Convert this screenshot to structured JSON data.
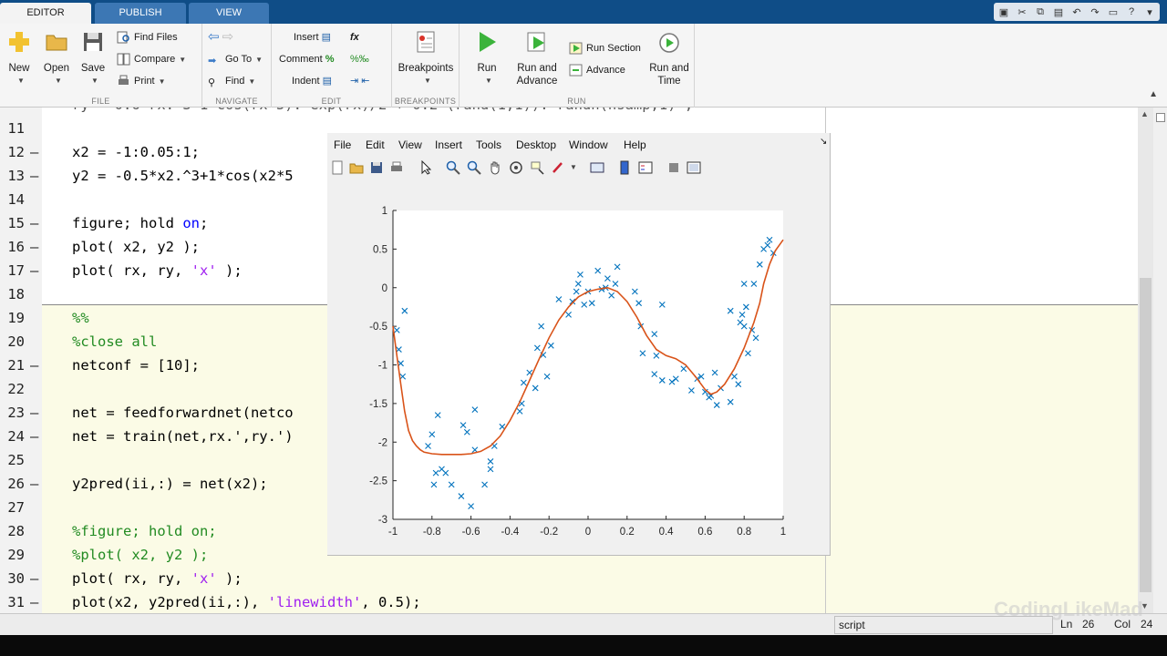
{
  "tabs": [
    "EDITOR",
    "PUBLISH",
    "VIEW"
  ],
  "ribbon": {
    "file": {
      "title": "FILE",
      "new": "New",
      "open": "Open",
      "save": "Save",
      "find_files": "Find Files",
      "compare": "Compare",
      "print": "Print"
    },
    "navigate": {
      "title": "NAVIGATE",
      "go_to": "Go To",
      "find": "Find"
    },
    "edit": {
      "title": "EDIT",
      "insert": "Insert",
      "fx": "fx",
      "comment": "Comment",
      "comment_symbol": "%",
      "indent": "Indent"
    },
    "breakpoints": {
      "title": "BREAKPOINTS",
      "label": "Breakpoints"
    },
    "run": {
      "title": "RUN",
      "run": "Run",
      "run_and_advance_1": "Run and",
      "run_and_advance_2": "Advance",
      "run_section": "Run Section",
      "advance": "Advance",
      "run_and_time_1": "Run and",
      "run_and_time_2": "Time"
    }
  },
  "editor": {
    "lines": [
      {
        "num": "11",
        "dash": false,
        "code": ""
      },
      {
        "num": "12",
        "dash": true,
        "code": "x2 = -1:0.05:1;"
      },
      {
        "num": "13",
        "dash": true,
        "code": "y2 = -0.5*x2.^3+1*cos(x2*5"
      },
      {
        "num": "14",
        "dash": false,
        "code": ""
      },
      {
        "num": "15",
        "dash": true,
        "code_a": "figure; hold ",
        "code_kw": "on",
        "code_b": ";"
      },
      {
        "num": "16",
        "dash": true,
        "code": "plot( x2, y2 );"
      },
      {
        "num": "17",
        "dash": true,
        "code_a": "plot( rx, ry, ",
        "code_str": "'x'",
        "code_b": " );"
      },
      {
        "num": "18",
        "dash": false,
        "code": ""
      },
      {
        "num": "19",
        "dash": false,
        "comment": "%%"
      },
      {
        "num": "20",
        "dash": false,
        "comment": "%close all"
      },
      {
        "num": "21",
        "dash": true,
        "code": "netconf = [10];"
      },
      {
        "num": "22",
        "dash": false,
        "code": ""
      },
      {
        "num": "23",
        "dash": true,
        "code": "net = feedforwardnet(netco"
      },
      {
        "num": "24",
        "dash": true,
        "code": "net = train(net,rx.',ry.')"
      },
      {
        "num": "25",
        "dash": false,
        "code": ""
      },
      {
        "num": "26",
        "dash": true,
        "code": "y2pred(ii,:) = net(x2);"
      },
      {
        "num": "27",
        "dash": false,
        "code": ""
      },
      {
        "num": "28",
        "dash": false,
        "comment": "%figure; hold on;"
      },
      {
        "num": "29",
        "dash": false,
        "comment": "%plot( x2, y2 );"
      },
      {
        "num": "30",
        "dash": true,
        "code_a": "plot( rx, ry, ",
        "code_str": "'x'",
        "code_b": " );"
      },
      {
        "num": "31",
        "dash": true,
        "code_a": "plot(x2, y2pred(ii,:), ",
        "code_str": "'linewidth'",
        "code_b": ", 0.5);"
      }
    ]
  },
  "figure": {
    "menu": [
      "File",
      "Edit",
      "View",
      "Insert",
      "Tools",
      "Desktop",
      "Window",
      "Help"
    ]
  },
  "chart_data": {
    "type": "scatter",
    "xlim": [
      -1,
      1
    ],
    "ylim": [
      -3,
      1
    ],
    "xticks": [
      "-1",
      "-0.8",
      "-0.6",
      "-0.4",
      "-0.2",
      "0",
      "0.2",
      "0.4",
      "0.6",
      "0.8",
      "1"
    ],
    "yticks": [
      "1",
      "0.5",
      "0",
      "-0.5",
      "-1",
      "-1.5",
      "-2",
      "-2.5",
      "-3"
    ],
    "marker_color": "#0072bd",
    "line_color": "#d95319",
    "series": [
      {
        "type": "scatter",
        "marker": "x",
        "points": [
          [
            -0.98,
            -0.55
          ],
          [
            -0.97,
            -0.8
          ],
          [
            -0.96,
            -0.98
          ],
          [
            -0.95,
            -1.15
          ],
          [
            -0.94,
            -0.3
          ],
          [
            -0.82,
            -2.05
          ],
          [
            -0.8,
            -1.9
          ],
          [
            -0.78,
            -2.4
          ],
          [
            -0.79,
            -2.55
          ],
          [
            -0.77,
            -1.65
          ],
          [
            -0.75,
            -2.35
          ],
          [
            -0.73,
            -2.4
          ],
          [
            -0.7,
            -2.55
          ],
          [
            -0.65,
            -2.7
          ],
          [
            -0.64,
            -1.78
          ],
          [
            -0.62,
            -1.87
          ],
          [
            -0.6,
            -2.83
          ],
          [
            -0.58,
            -2.1
          ],
          [
            -0.58,
            -1.58
          ],
          [
            -0.53,
            -2.55
          ],
          [
            -0.5,
            -2.35
          ],
          [
            -0.5,
            -2.25
          ],
          [
            -0.48,
            -2.05
          ],
          [
            -0.44,
            -1.8
          ],
          [
            -0.35,
            -1.6
          ],
          [
            -0.34,
            -1.5
          ],
          [
            -0.33,
            -1.23
          ],
          [
            -0.3,
            -1.1
          ],
          [
            -0.27,
            -1.3
          ],
          [
            -0.26,
            -0.78
          ],
          [
            -0.24,
            -0.5
          ],
          [
            -0.23,
            -0.87
          ],
          [
            -0.21,
            -1.15
          ],
          [
            -0.19,
            -0.75
          ],
          [
            -0.15,
            -0.15
          ],
          [
            -0.1,
            -0.35
          ],
          [
            -0.08,
            -0.18
          ],
          [
            -0.06,
            -0.05
          ],
          [
            -0.05,
            0.05
          ],
          [
            -0.04,
            0.17
          ],
          [
            -0.02,
            -0.22
          ],
          [
            0.0,
            -0.05
          ],
          [
            0.02,
            -0.2
          ],
          [
            0.05,
            0.22
          ],
          [
            0.07,
            -0.02
          ],
          [
            0.09,
            0.0
          ],
          [
            0.1,
            0.12
          ],
          [
            0.12,
            -0.1
          ],
          [
            0.14,
            0.05
          ],
          [
            0.15,
            0.27
          ],
          [
            0.24,
            -0.05
          ],
          [
            0.26,
            -0.2
          ],
          [
            0.27,
            -0.5
          ],
          [
            0.28,
            -0.85
          ],
          [
            0.34,
            -0.6
          ],
          [
            0.35,
            -0.88
          ],
          [
            0.34,
            -1.12
          ],
          [
            0.38,
            -1.2
          ],
          [
            0.38,
            -0.22
          ],
          [
            0.43,
            -1.22
          ],
          [
            0.45,
            -1.18
          ],
          [
            0.49,
            -1.05
          ],
          [
            0.53,
            -1.33
          ],
          [
            0.56,
            -1.18
          ],
          [
            0.58,
            -1.15
          ],
          [
            0.6,
            -1.35
          ],
          [
            0.62,
            -1.42
          ],
          [
            0.63,
            -1.4
          ],
          [
            0.65,
            -1.1
          ],
          [
            0.66,
            -1.52
          ],
          [
            0.68,
            -1.3
          ],
          [
            0.73,
            -1.48
          ],
          [
            0.73,
            -0.3
          ],
          [
            0.75,
            -1.15
          ],
          [
            0.77,
            -1.25
          ],
          [
            0.78,
            -0.45
          ],
          [
            0.79,
            -0.35
          ],
          [
            0.8,
            0.05
          ],
          [
            0.8,
            -0.5
          ],
          [
            0.81,
            -0.25
          ],
          [
            0.82,
            -0.85
          ],
          [
            0.84,
            -0.55
          ],
          [
            0.85,
            0.05
          ],
          [
            0.86,
            -0.65
          ],
          [
            0.88,
            0.3
          ],
          [
            0.9,
            0.5
          ],
          [
            0.92,
            0.55
          ],
          [
            0.93,
            0.62
          ],
          [
            0.95,
            0.45
          ]
        ]
      },
      {
        "type": "line",
        "points": [
          [
            -1,
            -0.5
          ],
          [
            -0.98,
            -0.88
          ],
          [
            -0.96,
            -1.25
          ],
          [
            -0.94,
            -1.6
          ],
          [
            -0.92,
            -1.85
          ],
          [
            -0.9,
            -1.98
          ],
          [
            -0.88,
            -2.05
          ],
          [
            -0.86,
            -2.1
          ],
          [
            -0.84,
            -2.13
          ],
          [
            -0.8,
            -2.15
          ],
          [
            -0.75,
            -2.16
          ],
          [
            -0.7,
            -2.16
          ],
          [
            -0.65,
            -2.16
          ],
          [
            -0.6,
            -2.15
          ],
          [
            -0.55,
            -2.12
          ],
          [
            -0.5,
            -2.05
          ],
          [
            -0.45,
            -1.92
          ],
          [
            -0.4,
            -1.72
          ],
          [
            -0.35,
            -1.48
          ],
          [
            -0.3,
            -1.2
          ],
          [
            -0.25,
            -0.92
          ],
          [
            -0.2,
            -0.65
          ],
          [
            -0.15,
            -0.42
          ],
          [
            -0.1,
            -0.25
          ],
          [
            -0.05,
            -0.12
          ],
          [
            0.0,
            -0.05
          ],
          [
            0.05,
            -0.02
          ],
          [
            0.1,
            0.0
          ],
          [
            0.15,
            -0.05
          ],
          [
            0.2,
            -0.18
          ],
          [
            0.25,
            -0.38
          ],
          [
            0.3,
            -0.62
          ],
          [
            0.35,
            -0.8
          ],
          [
            0.4,
            -0.88
          ],
          [
            0.45,
            -0.92
          ],
          [
            0.5,
            -1.0
          ],
          [
            0.55,
            -1.15
          ],
          [
            0.6,
            -1.32
          ],
          [
            0.63,
            -1.38
          ],
          [
            0.66,
            -1.35
          ],
          [
            0.7,
            -1.25
          ],
          [
            0.75,
            -1.05
          ],
          [
            0.8,
            -0.78
          ],
          [
            0.85,
            -0.45
          ],
          [
            0.88,
            -0.2
          ],
          [
            0.9,
            0.05
          ],
          [
            0.93,
            0.3
          ],
          [
            0.96,
            0.48
          ],
          [
            1.0,
            0.62
          ]
        ]
      }
    ]
  },
  "status": {
    "script": "script",
    "ln_label": "Ln",
    "ln_value": "26",
    "col_label": "Col",
    "col_value": "24"
  },
  "watermark": "CodingLikeMad"
}
